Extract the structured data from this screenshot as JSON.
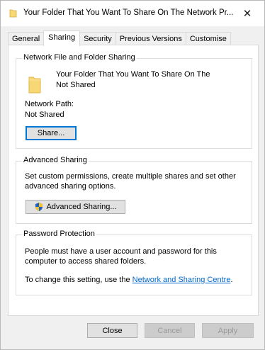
{
  "window": {
    "title": "Your Folder That You Want To Share On The Network Pr...",
    "close_symbol": "✕"
  },
  "tabs": [
    {
      "label": "General"
    },
    {
      "label": "Sharing"
    },
    {
      "label": "Security"
    },
    {
      "label": "Previous Versions"
    },
    {
      "label": "Customise"
    }
  ],
  "network_sharing": {
    "legend": "Network File and Folder Sharing",
    "folder_name_line1": "Your Folder That You Want To Share On The",
    "folder_name_line2": "Not Shared",
    "network_path_label": "Network Path:",
    "network_path_value": "Not Shared",
    "share_button": "Share..."
  },
  "advanced_sharing": {
    "legend": "Advanced Sharing",
    "description_line1": "Set custom permissions, create multiple shares and set other",
    "description_line2": "advanced sharing options.",
    "button": "Advanced Sharing..."
  },
  "password_protection": {
    "legend": "Password Protection",
    "description_line1": "People must have a user account and password for this",
    "description_line2": "computer to access shared folders.",
    "change_text": "To change this setting, use the ",
    "link_text": "Network and Sharing Centre",
    "trailing": "."
  },
  "footer": {
    "close": "Close",
    "cancel": "Cancel",
    "apply": "Apply"
  },
  "colors": {
    "accent": "#0078d7",
    "link": "#0066cc",
    "folder": "#f8d775"
  }
}
